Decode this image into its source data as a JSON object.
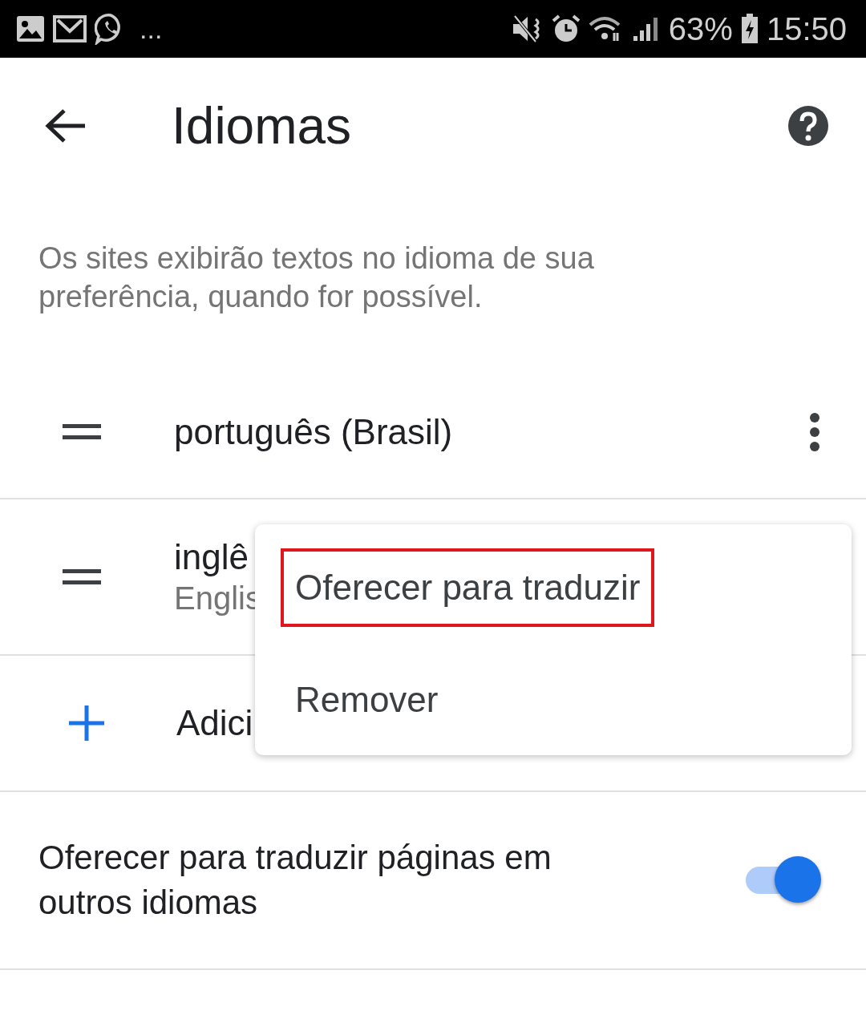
{
  "status_bar": {
    "overflow": "...",
    "battery": "63%",
    "time": "15:50"
  },
  "header": {
    "title": "Idiomas"
  },
  "description": "Os sites exibirão textos no idioma de sua preferência, quando for possível.",
  "languages": [
    {
      "name": "português (Brasil)"
    },
    {
      "name": "inglê",
      "subtitle": "Englis"
    }
  ],
  "add_item": {
    "label": "Adici"
  },
  "translate_setting": {
    "label": "Oferecer para traduzir páginas em outros idiomas",
    "on": true
  },
  "context_menu": [
    {
      "label": "Oferecer para traduzir",
      "highlighted": true
    },
    {
      "label": "Remover",
      "highlighted": false
    }
  ]
}
